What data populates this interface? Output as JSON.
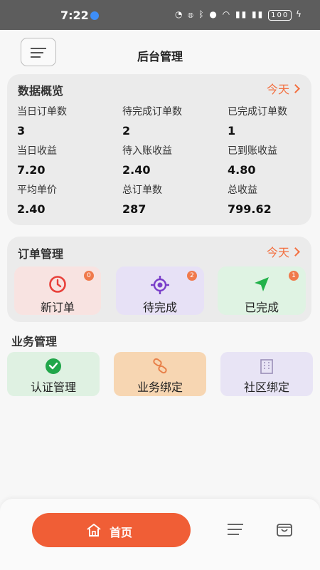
{
  "status_bar": {
    "time": "7:22",
    "battery": "100"
  },
  "header": {
    "title": "后台管理",
    "menu_icon": "menu-icon"
  },
  "overview": {
    "title": "数据概览",
    "filter": "今天",
    "stats": [
      {
        "label": "当日订单数",
        "value": "3"
      },
      {
        "label": "待完成订单数",
        "value": "2"
      },
      {
        "label": "已完成订单数",
        "value": "1"
      },
      {
        "label": "当日收益",
        "value": "7.20"
      },
      {
        "label": "待入账收益",
        "value": "2.40"
      },
      {
        "label": "已到账收益",
        "value": "4.80"
      },
      {
        "label": "平均单价",
        "value": "2.40"
      },
      {
        "label": "总订单数",
        "value": "287"
      },
      {
        "label": "总收益",
        "value": "799.62"
      }
    ]
  },
  "orders": {
    "title": "订单管理",
    "filter": "今天",
    "tiles": [
      {
        "label": "新订单",
        "badge": "0",
        "icon": "clock-icon",
        "color": "#e8403a",
        "bg": "#f8e3e1"
      },
      {
        "label": "待完成",
        "badge": "2",
        "icon": "target-icon",
        "color": "#7a3fc9",
        "bg": "#e7e1f6"
      },
      {
        "label": "已完成",
        "badge": "1",
        "icon": "send-arrow-icon",
        "color": "#23b24b",
        "bg": "#dff3e3"
      }
    ]
  },
  "business": {
    "title": "业务管理",
    "tiles": [
      {
        "label": "认证管理",
        "icon": "check-circle-icon",
        "color": "#21a64a",
        "bg": "#dff1e2"
      },
      {
        "label": "业务绑定",
        "icon": "link-icon",
        "color": "#e8814a",
        "bg": "#f7d6b2"
      },
      {
        "label": "社区绑定",
        "icon": "building-icon",
        "color": "#9a8fb8",
        "bg": "#e8e4f5"
      }
    ]
  },
  "bottom_nav": {
    "home_label": "首页",
    "accent": "#f05e36",
    "items": [
      "home-icon",
      "list-icon",
      "cart-icon"
    ]
  }
}
